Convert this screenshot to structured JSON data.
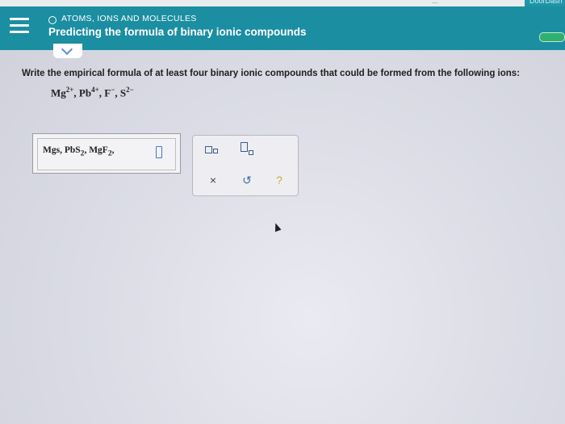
{
  "topbar": {
    "partial_text": "...",
    "corner_label": "DoorDash"
  },
  "header": {
    "topic": "ATOMS, IONS AND MOLECULES",
    "title": "Predicting the formula of binary ionic compounds"
  },
  "question": {
    "prompt": "Write the empirical formula of at least four binary ionic compounds that could be formed from the following ions:",
    "ions": [
      {
        "base": "Mg",
        "charge": "2+"
      },
      {
        "base": "Pb",
        "charge": "4+"
      },
      {
        "base": "F",
        "charge": "−"
      },
      {
        "base": "S",
        "charge": "2−"
      }
    ],
    "separator": ", "
  },
  "answer": {
    "value_prefix": "Mgs, PbS",
    "value_sub1": "2",
    "value_mid": ", MgF",
    "value_sub2": "2",
    "value_suffix": ","
  },
  "tools": {
    "clear_symbol": "×",
    "undo_symbol": "↺",
    "help_symbol": "?"
  },
  "colors": {
    "header_bg": "#1b8ea1",
    "accent_blue": "#4f73c8"
  }
}
